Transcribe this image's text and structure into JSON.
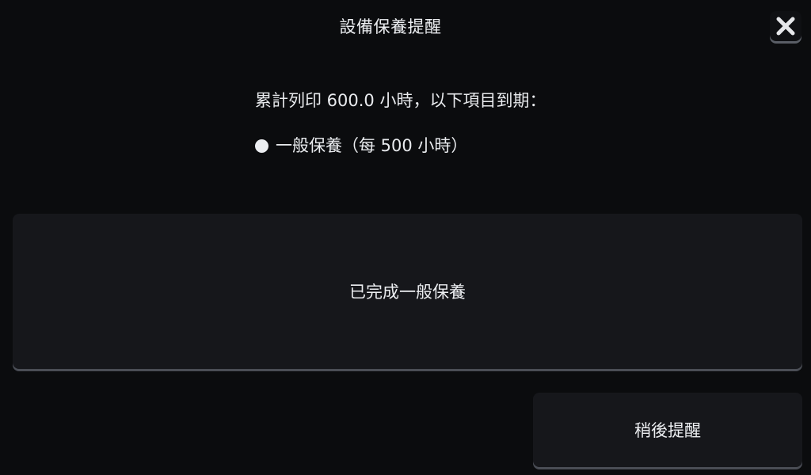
{
  "dialog": {
    "title": "設備保養提醒",
    "close_icon": "close-icon"
  },
  "message": {
    "summary": "累計列印 600.0 小時，以下項目到期：",
    "items": [
      {
        "label": "一般保養（每 500 小時）"
      }
    ]
  },
  "actions": {
    "complete_label": "已完成一般保養",
    "later_label": "稍後提醒"
  },
  "colors": {
    "background": "#0b0c0e",
    "button_bg": "#16171b",
    "button_shadow": "#4a4d55",
    "text": "#eceef1"
  }
}
